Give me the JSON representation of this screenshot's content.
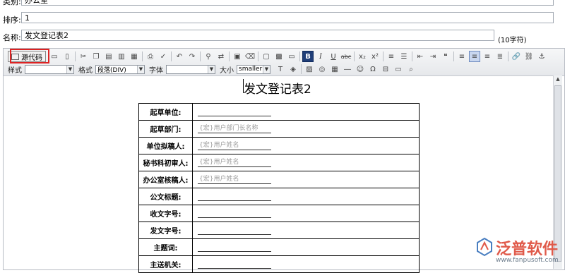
{
  "fields": {
    "category_label": "类别:",
    "category_value": "办公室",
    "order_label": "排序:",
    "order_value": "1",
    "name_label": "名称:",
    "name_value": "发文登记表2",
    "name_hint": "(10字符)"
  },
  "toolbar": {
    "source_label": "源代码",
    "style_label": "样式",
    "style_value": "",
    "format_label": "格式",
    "format_value": "段落(DIV)",
    "font_label": "字体",
    "font_value": "",
    "size_label": "大小",
    "size_value": "smaller",
    "bold": "B",
    "italic": "I",
    "underline": "U",
    "strike": "abc",
    "subscript": "x₂",
    "superscript": "x²"
  },
  "document": {
    "title": "发文登记表2",
    "rows": [
      {
        "label": "起草单位:",
        "value": ""
      },
      {
        "label": "起草部门:",
        "value": "{宏}用户部门长名称"
      },
      {
        "label": "单位拟稿人:",
        "value": "{宏}用户姓名"
      },
      {
        "label": "秘书科初审人:",
        "value": "{宏}用户姓名"
      },
      {
        "label": "办公室核稿人:",
        "value": "{宏}用户姓名"
      },
      {
        "label": "公文标题:",
        "value": ""
      },
      {
        "label": "收文字号:",
        "value": ""
      },
      {
        "label": "发文字号:",
        "value": ""
      },
      {
        "label": "主题词:",
        "value": ""
      },
      {
        "label": "主送机关:",
        "value": ""
      }
    ]
  },
  "watermark": {
    "name": "泛普软件",
    "url": "www.fanpusoft.com"
  }
}
